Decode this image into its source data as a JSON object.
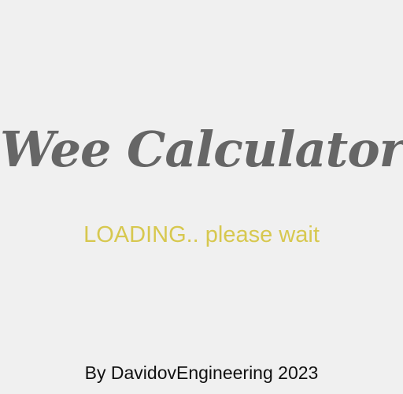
{
  "splash": {
    "logo_text": "Wee Calculator",
    "loading_text": "LOADING.. please wait",
    "footer_text": "By DavidovEngineering 2023"
  },
  "colors": {
    "background": "#f0f0f0",
    "logo": "#666666",
    "loading": "#d7c84f",
    "footer": "#111111"
  }
}
